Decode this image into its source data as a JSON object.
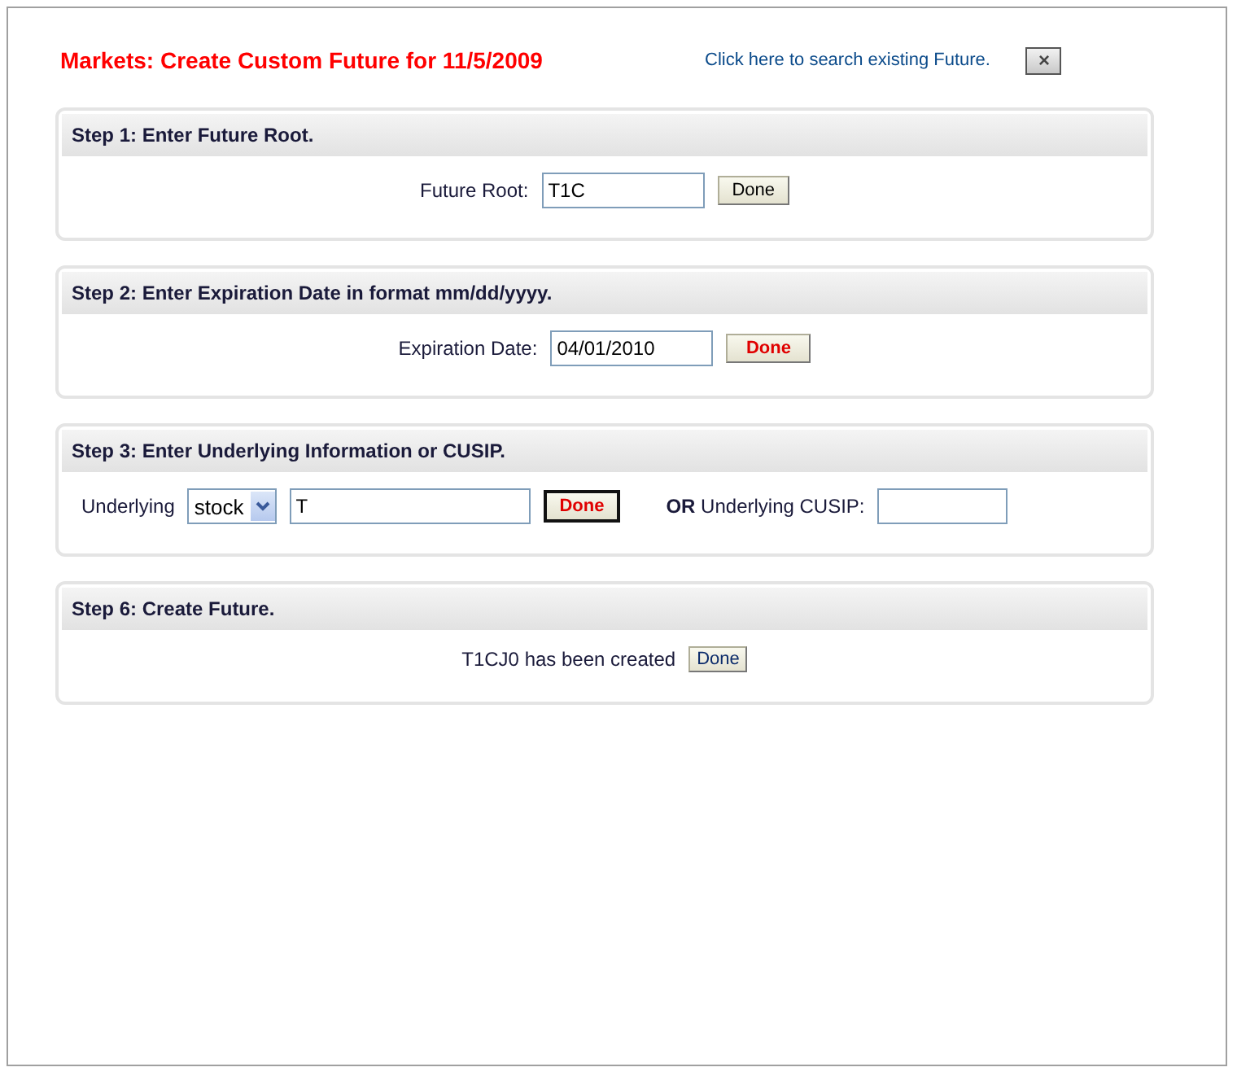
{
  "title": "Markets: Create Custom Future for 11/5/2009",
  "search_link": "Click here to search existing Future.",
  "close_button": {
    "label": "×"
  },
  "steps": [
    {
      "heading": "Step 1: Enter Future Root.",
      "items": [
        {
          "kind": "label",
          "text": "Future Root:"
        },
        {
          "kind": "input",
          "value": "T1C"
        },
        {
          "kind": "button",
          "label": "Done"
        }
      ]
    },
    {
      "heading": "Step 2: Enter Expiration Date in format mm/dd/yyyy.",
      "items": [
        {
          "kind": "label",
          "text": "Expiration Date:"
        },
        {
          "kind": "input",
          "value": "04/01/2010"
        },
        {
          "kind": "button",
          "label": "Done"
        }
      ]
    },
    {
      "heading": "Step 3: Enter Underlying Information or CUSIP.",
      "items": [
        {
          "kind": "label",
          "text": "Underlying"
        },
        {
          "kind": "select",
          "value": "stock"
        },
        {
          "kind": "input",
          "value": "T"
        },
        {
          "kind": "button",
          "label": "Done"
        },
        {
          "kind": "rich-label",
          "text": "**OR** Underlying CUSIP:"
        },
        {
          "kind": "input",
          "value": ""
        }
      ]
    },
    {
      "heading": "Step 6: Create Future.",
      "items": [
        {
          "kind": "label",
          "text": "T1CJ0 has been created"
        },
        {
          "kind": "button",
          "label": "Done"
        }
      ]
    }
  ]
}
